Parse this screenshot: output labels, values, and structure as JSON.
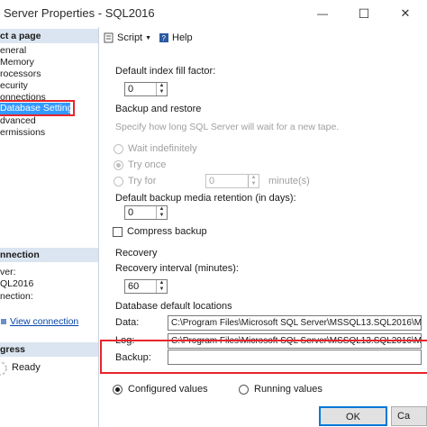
{
  "window": {
    "title": "Server Properties - SQL2016",
    "minimize_glyph": "—",
    "maximize_glyph": "☐",
    "close_glyph": "✕"
  },
  "left_pane": {
    "select_page_header": "ct a page",
    "pages": [
      "eneral",
      "Memory",
      "rocessors",
      "ecurity",
      "onnections",
      "Database Settings",
      "dvanced",
      "ermissions"
    ],
    "connection_header": "nnection",
    "server_label": "ver:",
    "server_value": "QL2016",
    "connection_label": "nection:",
    "view_connection_link": "View connection",
    "progress_header": "gress",
    "progress_status": "Ready"
  },
  "toolbar": {
    "script_label": "Script",
    "help_label": "Help"
  },
  "settings": {
    "fill_factor_label": "Default index fill factor:",
    "fill_factor_value": "0",
    "backup_restore_label": "Backup and restore",
    "tape_wait_label": "Specify how long SQL Server will wait for a new tape.",
    "wait_indefinitely": "Wait indefinitely",
    "try_once": "Try once",
    "try_for": "Try for",
    "try_for_value": "0",
    "minutes_label": "minute(s)",
    "retention_label": "Default backup media retention (in days):",
    "retention_value": "0",
    "compress_backup": "Compress backup",
    "recovery_label": "Recovery",
    "recovery_interval_label": "Recovery interval (minutes):",
    "recovery_interval_value": "60",
    "default_locations_label": "Database default locations",
    "data_label": "Data:",
    "data_value": "C:\\Program Files\\Microsoft SQL Server\\MSSQL13.SQL2016\\M",
    "log_label": "Log:",
    "log_value": "C:\\Program Files\\Microsoft SQL Server\\MSSQL13.SQL2016\\M",
    "backup_label": "Backup:",
    "backup_value": ""
  },
  "bottom": {
    "configured_values": "Configured values",
    "running_values": "Running values",
    "ok_label": "OK",
    "cancel_label": "Ca"
  },
  "colors": {
    "highlight_red": "#e8242c",
    "selection_blue": "#3399ff",
    "section_header_bg": "#dbe5f1"
  }
}
